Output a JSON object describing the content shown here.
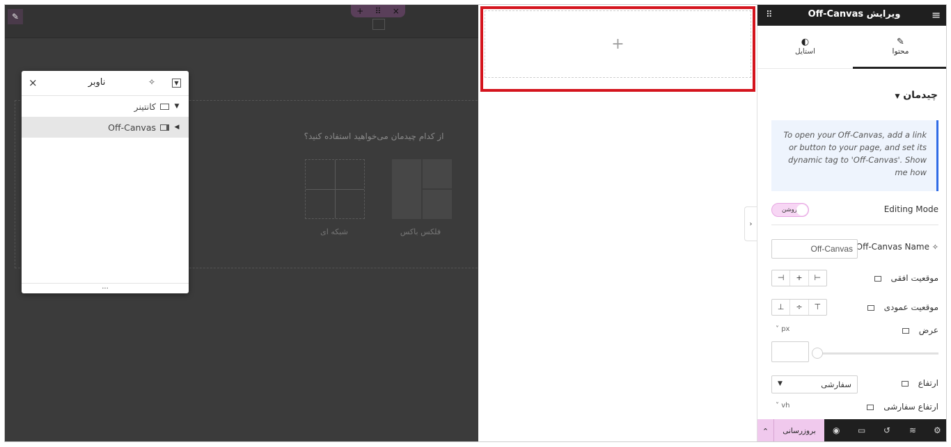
{
  "canvas": {
    "edit_icon": "pencil-icon",
    "container_handles": [
      "+",
      "⠿",
      "×"
    ],
    "layout_prompt": "از کدام چیدمان می‌خواهید استفاده کنید؟",
    "layouts": [
      {
        "label": "فلکس باکس"
      },
      {
        "label": "شبکه ای"
      }
    ]
  },
  "navigator": {
    "title": "ناوبر",
    "close_icon": "×",
    "items": [
      {
        "label": "کانتینر",
        "caret": "▼"
      },
      {
        "label": "Off-Canvas",
        "caret": "◀"
      }
    ],
    "footer": "..."
  },
  "offcanvas_preview": {
    "add_icon": "+",
    "highlight_color": "#d4141d"
  },
  "panel": {
    "title": "ویرایش Off-Canvas",
    "tabs": [
      {
        "label": "محتوا",
        "icon": "pencil-icon",
        "active": true
      },
      {
        "label": "استایل",
        "icon": "half-circle-icon",
        "active": false
      }
    ],
    "section_title": "چیدمان",
    "info_text": "To open your Off-Canvas, add a link or button to your page, and set its dynamic tag to 'Off-Canvas'. Show me how",
    "editing_mode": {
      "label": "Editing Mode",
      "toggle_text": "روشن"
    },
    "name_field": {
      "label": "Off-Canvas Name",
      "value": "Off-Canvas"
    },
    "horizontal_position": {
      "label": "موقعیت افقی"
    },
    "vertical_position": {
      "label": "موقعیت عمودی"
    },
    "width": {
      "label": "عرض",
      "unit": "px"
    },
    "height": {
      "label": "ارتفاع",
      "value": "سفارشی"
    },
    "custom_height": {
      "label": "ارتفاع سفارشی",
      "unit": "vh"
    },
    "bottom_bar": {
      "publish_label": "بروزرسانی"
    }
  },
  "colors": {
    "accent_pink": "#f0c9ed",
    "info_border": "#2f6be6",
    "header_dark": "#1f1f1f"
  }
}
